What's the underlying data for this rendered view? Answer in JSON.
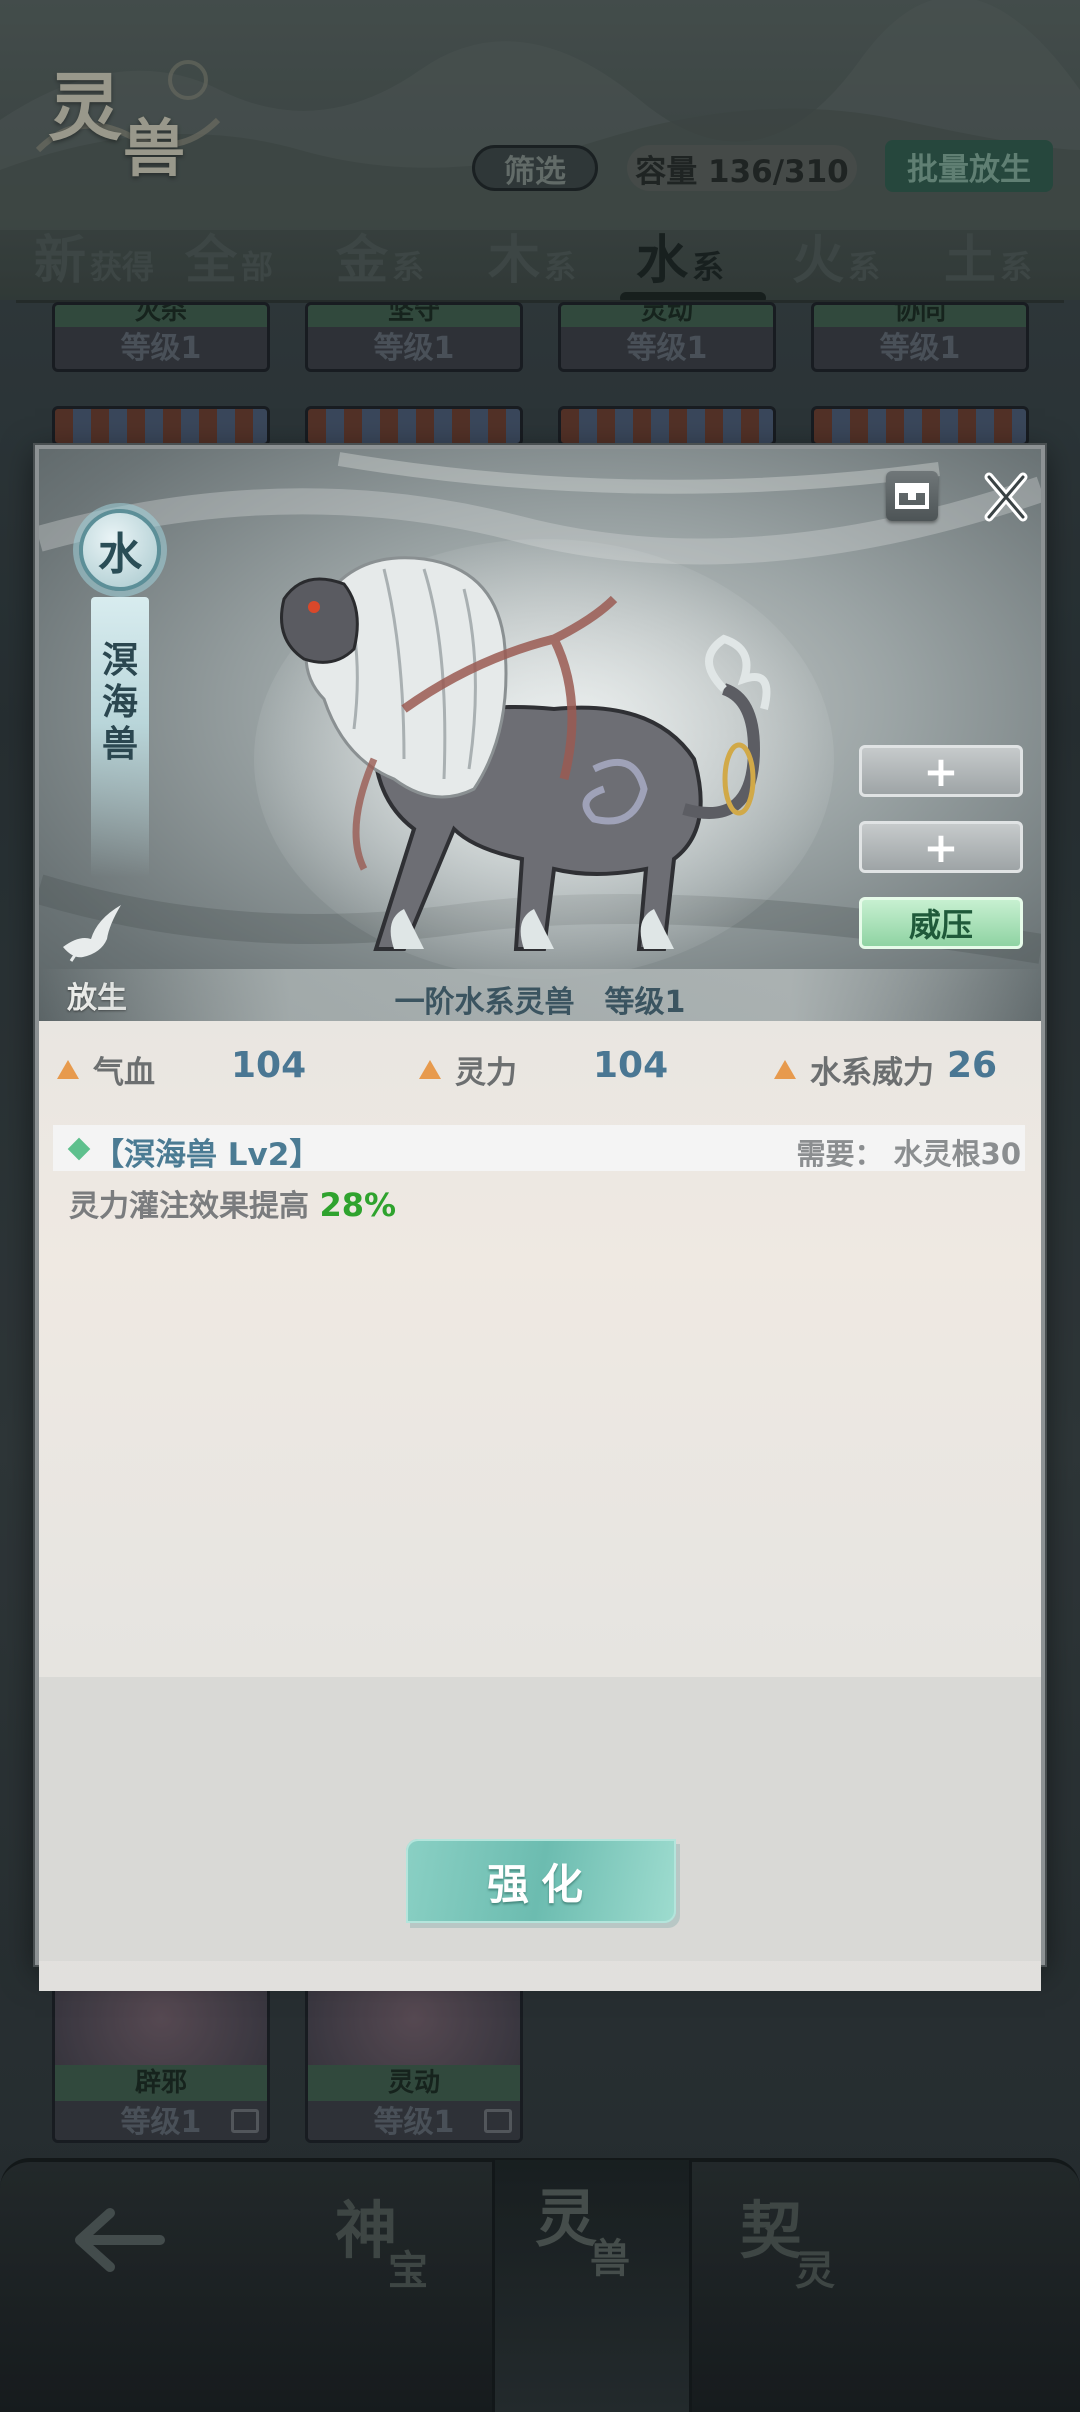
{
  "header": {
    "logo_char1": "灵",
    "logo_char2": "兽",
    "filter_label": "筛选",
    "capacity_label": "容量 136/310",
    "batch_release_label": "批量放生"
  },
  "tabs": [
    {
      "big": "新",
      "small": "获得"
    },
    {
      "big": "全",
      "small": "部"
    },
    {
      "big": "金",
      "small": "系"
    },
    {
      "big": "木",
      "small": "系"
    },
    {
      "big": "水",
      "small": "系",
      "active": true
    },
    {
      "big": "火",
      "small": "系"
    },
    {
      "big": "土",
      "small": "系"
    }
  ],
  "grid_top": [
    {
      "name": "灭杀",
      "level": "等级1"
    },
    {
      "name": "坚守",
      "level": "等级1"
    },
    {
      "name": "灵动",
      "level": "等级1"
    },
    {
      "name": "协同",
      "level": "等级1"
    }
  ],
  "grid_bottom": [
    {
      "name": "辟邪",
      "level": "等级1"
    },
    {
      "name": "灵动",
      "level": "等级1"
    }
  ],
  "bottom_nav": [
    {
      "big": "神",
      "small": "宝"
    },
    {
      "big": "灵",
      "small": "兽",
      "active": true
    },
    {
      "big": "契",
      "small": "灵"
    }
  ],
  "modal": {
    "element": "水",
    "beast_name_chars": [
      "溟",
      "海",
      "兽"
    ],
    "release_label": "放生",
    "side_buttons": {
      "plus1": "+",
      "plus2": "+",
      "skill": "威压"
    },
    "caption": "一阶水系灵兽　等级1",
    "stats": [
      {
        "label": "气血",
        "value": "104"
      },
      {
        "label": "灵力",
        "value": "104"
      },
      {
        "label": "水系威力",
        "value": "26"
      }
    ],
    "skill": {
      "title": "【溟海兽 Lv2】",
      "requirement": "需要：  水灵根30",
      "desc_prefix": "灵力灌注效果提高 ",
      "desc_value": "28%"
    },
    "enhance_label": "强化"
  },
  "colors": {
    "accent_value": "#4a7793",
    "bonus_green": "#2fa32e",
    "skill_button": "#8fd3a3",
    "enhance_button": "#6cbcb0"
  }
}
